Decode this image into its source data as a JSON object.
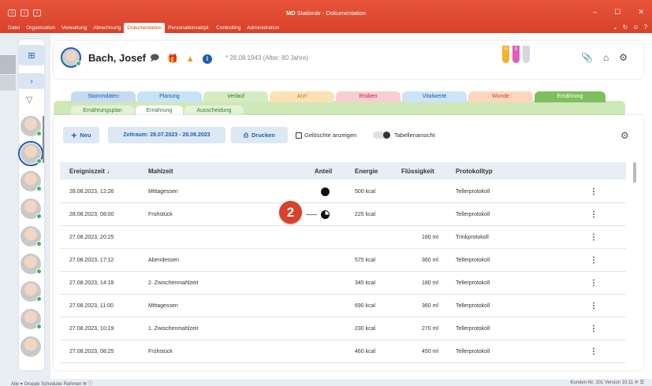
{
  "window": {
    "title_bold": "MD",
    "title_rest": " Stationär - Dokumentation",
    "controls": [
      "–",
      "☐",
      "✕"
    ]
  },
  "menu": {
    "items": [
      "Datei",
      "Organisation",
      "Verwaltung",
      "Abrechnung",
      "Dokumentation",
      "Personaleinsatzpl.",
      "Controlling",
      "Administration"
    ],
    "active": "Dokumentation",
    "right_icons": [
      "chevron-down-icon",
      "refresh-icon",
      "smiley-icon",
      "help-icon"
    ]
  },
  "patient": {
    "name": "Bach, Josef",
    "birth": "* 28.08.1943 (Alter: 80 Jahre)",
    "hs_tubes": [
      {
        "label": "H",
        "color": "#f3b12c"
      },
      {
        "label": "S",
        "color": "#e35db6"
      },
      {
        "label": "",
        "color": "#d7d7d7"
      }
    ]
  },
  "tabs_main": [
    {
      "label": "Stammdaten",
      "color": "#c8daf0",
      "text": "#1a5fb4"
    },
    {
      "label": "Planung",
      "color": "#c7e3f5",
      "text": "#1a5fb4"
    },
    {
      "label": "Verlauf",
      "color": "#d6ebc2",
      "text": "#2e7d32"
    },
    {
      "label": "Arzt",
      "color": "#fbe1b6",
      "text": "#d17a00"
    },
    {
      "label": "Risiken",
      "color": "#f7cfd3",
      "text": "#c62828"
    },
    {
      "label": "Vitalwerte",
      "color": "#cde3f6",
      "text": "#1a5fb4"
    },
    {
      "label": "Wunde",
      "color": "#fbd7be",
      "text": "#d84315"
    },
    {
      "label": "Ernährung",
      "color": "#7fbf5f",
      "text": "#ffffff"
    }
  ],
  "tabs_sub": [
    {
      "label": "Ernährungsplan",
      "active": false
    },
    {
      "label": "Ernährung",
      "active": true
    },
    {
      "label": "Ausscheidung",
      "active": false
    }
  ],
  "toolbar": {
    "new_label": "Neu",
    "range_label": "Zeitraum: 28.07.2023 - 28.08.2023",
    "print_label": "Drucken",
    "deleted_label": "Gelöschte anzeigen",
    "table_view_label": "Tabellenansicht"
  },
  "table": {
    "headers": [
      "Ereigniszeit ↓",
      "Mahlzeit",
      "Anteil",
      "Energie",
      "Flüssigkeit",
      "Protokolltyp"
    ],
    "rows": [
      {
        "time": "28.08.2023, 12:26",
        "meal": "Mittagessen",
        "share": "full",
        "energy": "500 kcal",
        "fluid": "",
        "type": "Tellerprotokoll"
      },
      {
        "time": "28.08.2023, 08:00",
        "meal": "Frühstück",
        "share": "three-quarter",
        "energy": "225 kcal",
        "fluid": "",
        "type": "Tellerprotokoll"
      },
      {
        "time": "27.08.2023, 20:25",
        "meal": "",
        "share": "",
        "energy": "",
        "fluid": "180 ml",
        "type": "Trinkprotokoll"
      },
      {
        "time": "27.08.2023, 17:12",
        "meal": "Abendessen",
        "share": "",
        "energy": "575 kcal",
        "fluid": "360 ml",
        "type": "Tellerprotokoll"
      },
      {
        "time": "27.08.2023, 14:18",
        "meal": "2. Zwischenmahlzeit",
        "share": "",
        "energy": "345 kcal",
        "fluid": "180 ml",
        "type": "Tellerprotokoll"
      },
      {
        "time": "27.08.2023, 11:00",
        "meal": "Mittagessen",
        "share": "",
        "energy": "690 kcal",
        "fluid": "360 ml",
        "type": "Tellerprotokoll"
      },
      {
        "time": "27.08.2023, 10:19",
        "meal": "1. Zwischenmahlzeit",
        "share": "",
        "energy": "230 kcal",
        "fluid": "270 ml",
        "type": "Tellerprotokoll"
      },
      {
        "time": "27.08.2023, 08:25",
        "meal": "Frühstück",
        "share": "",
        "energy": "460 kcal",
        "fluid": "450 ml",
        "type": "Tellerprotokoll"
      }
    ]
  },
  "callout": {
    "number": "2"
  },
  "statusbar": {
    "left": "Alle ▾  Gruppe  Scheduler  Rahmen  ✉  ⓘ",
    "right": "Kunden-Nr. 101  Version 10.11  ⟳  ☰"
  },
  "colors": {
    "brand": "#d8412a",
    "accent": "#1a5fb4",
    "online": "#3cb371"
  }
}
